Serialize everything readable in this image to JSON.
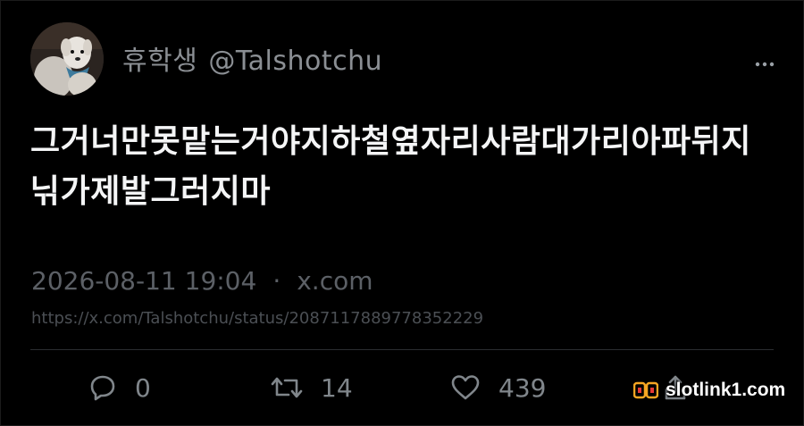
{
  "user": {
    "display_name": "휴학생",
    "handle": "@Talshotchu"
  },
  "tweet": {
    "text": "그거너만못맡는거야지하철옆자리사람대가리아파뒤지닊가제발그러지마",
    "timestamp": "2026-08-11 19:04",
    "separator": "·",
    "source": "x.com",
    "url": "https://x.com/Talshotchu/status/2087117889778352229"
  },
  "actions": {
    "reply_count": "0",
    "retweet_count": "14",
    "like_count": "439"
  },
  "icons": {
    "more": "more-dots-icon",
    "reply": "reply-bubble-icon",
    "retweet": "retweet-icon",
    "like": "heart-icon",
    "share": "share-icon"
  },
  "watermark": {
    "text": "slotlink1.com",
    "accent": "#f5a623"
  },
  "colors": {
    "background": "#000000",
    "text_primary": "#f4f5f6",
    "text_secondary": "#80868b"
  }
}
